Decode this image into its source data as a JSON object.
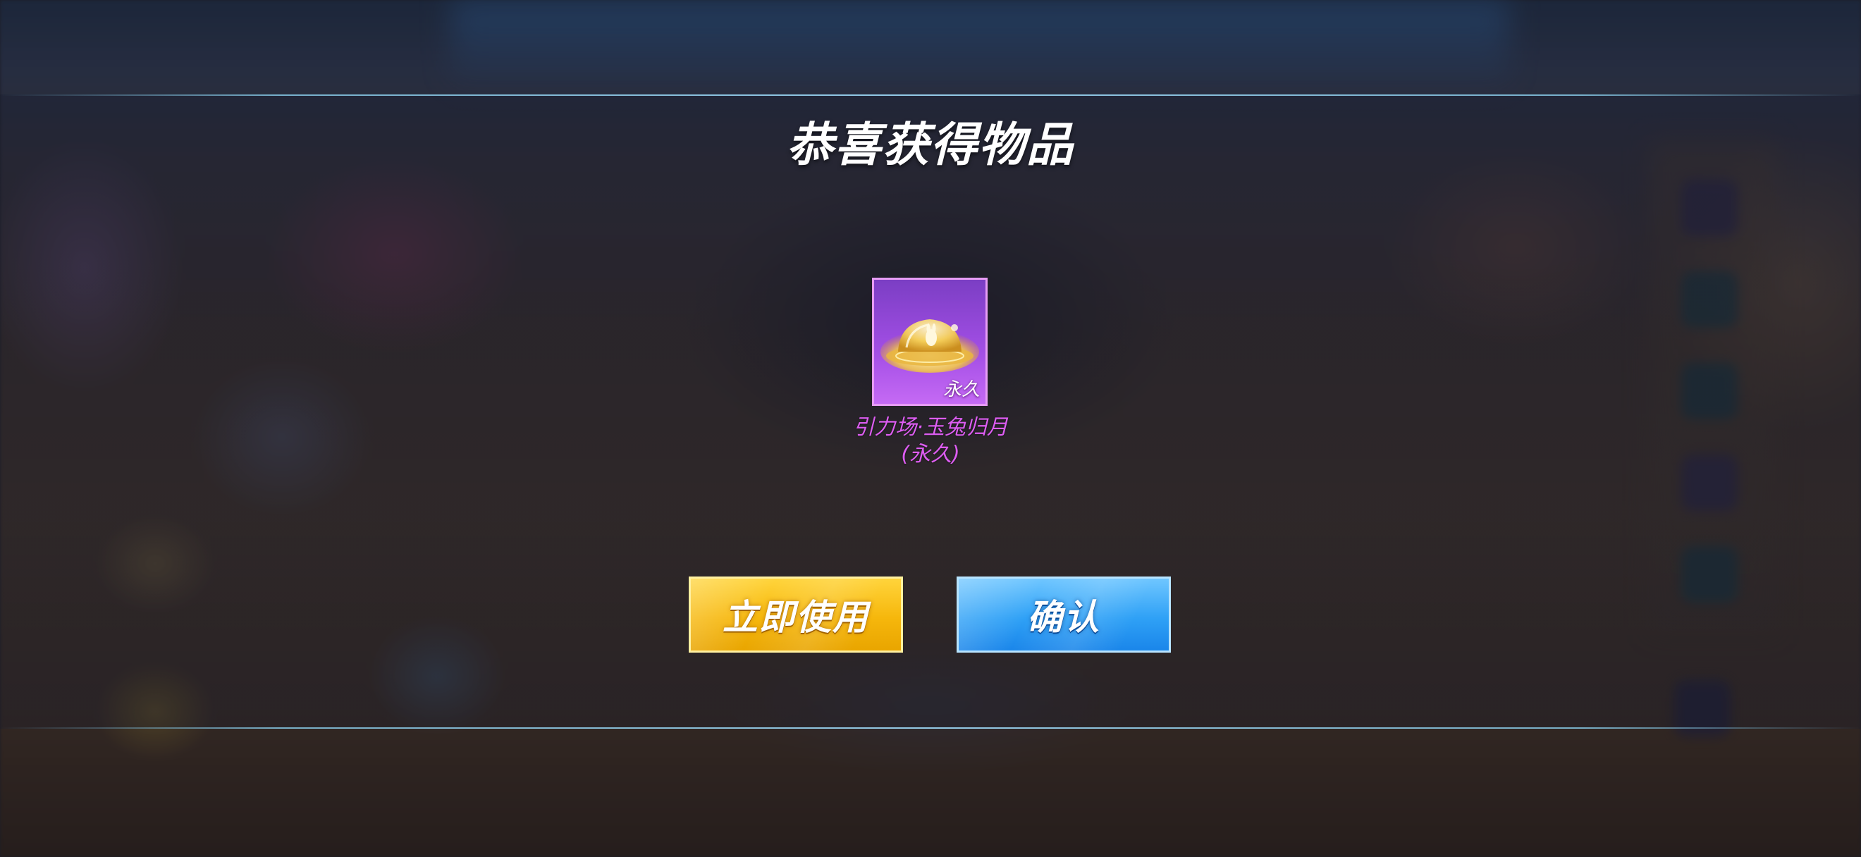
{
  "dialog": {
    "title": "恭喜获得物品"
  },
  "reward": {
    "icon": "golden-dome-gravity-field-icon",
    "tag": "永久",
    "name_line1": "引力场·玉兔归月",
    "name_line2": "(永久)",
    "rarity_color": "#dd5df2"
  },
  "buttons": {
    "use_now": "立即使用",
    "confirm": "确认"
  },
  "colors": {
    "use_button": "#f6b70c",
    "confirm_button": "#2fa1f6",
    "card_background": "#a44fe6",
    "band_line": "#8cd2f0"
  }
}
